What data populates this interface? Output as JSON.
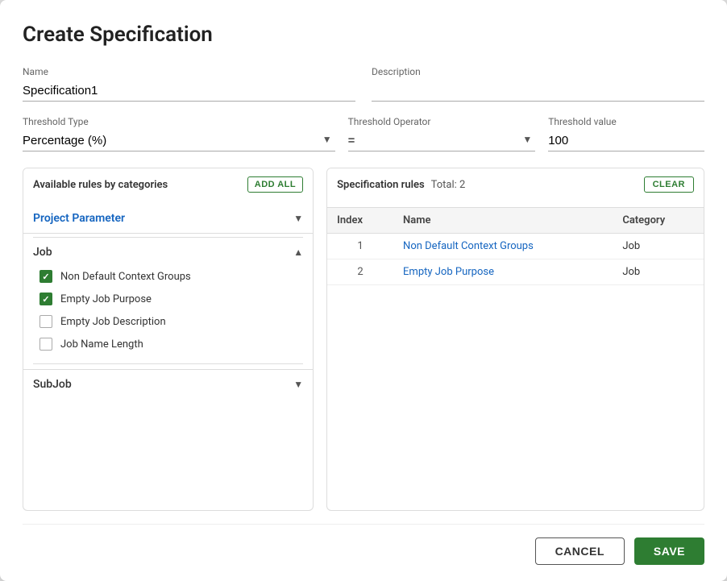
{
  "dialog": {
    "title": "Create Specification"
  },
  "form": {
    "name_label": "Name",
    "name_value": "Specification1",
    "description_label": "Description",
    "description_value": "",
    "threshold_type_label": "Threshold Type",
    "threshold_type_value": "Percentage (%)",
    "threshold_operator_label": "Threshold Operator",
    "threshold_operator_value": "=",
    "threshold_value_label": "Threshold value",
    "threshold_value": "100"
  },
  "available_panel": {
    "title": "Available rules by categories",
    "add_all_label": "ADD ALL",
    "category_label": "Project Parameter",
    "group_label": "Job",
    "rules": [
      {
        "id": 1,
        "name": "Non Default Context Groups",
        "checked": true
      },
      {
        "id": 2,
        "name": "Empty Job Purpose",
        "checked": true
      },
      {
        "id": 3,
        "name": "Empty Job Description",
        "checked": false
      },
      {
        "id": 4,
        "name": "Job Name Length",
        "checked": false
      }
    ],
    "subjob_label": "SubJob"
  },
  "spec_panel": {
    "title": "Specification rules",
    "total_label": "Total: 2",
    "clear_label": "CLEAR",
    "columns": [
      "Index",
      "Name",
      "Category"
    ],
    "rows": [
      {
        "index": 1,
        "name": "Non Default Context Groups",
        "category": "Job"
      },
      {
        "index": 2,
        "name": "Empty Job Purpose",
        "category": "Job"
      }
    ]
  },
  "footer": {
    "cancel_label": "CANCEL",
    "save_label": "SAVE"
  }
}
